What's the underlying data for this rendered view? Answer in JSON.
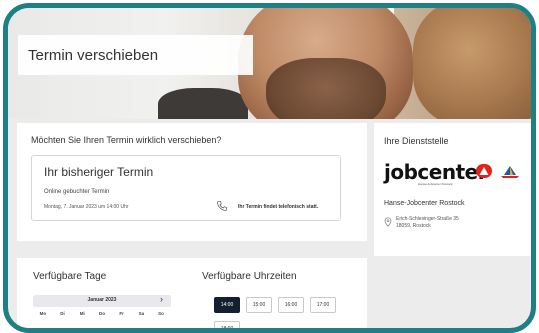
{
  "header": {
    "title": "Termin verschieben"
  },
  "question": {
    "heading": "Möchten Sie Ihren Termin wirklich verschieben?",
    "previous": {
      "title": "Ihr bisheriger Termin",
      "type": "Online gebuchter Termin",
      "datetime": "Montag, 7. Januar 2023 um 14:00 Uhr",
      "phone_note": "Ihr Termin findet telefonisch statt."
    }
  },
  "office": {
    "heading": "Ihre Dienststelle",
    "logo_text": "jobcenter",
    "logo_subtext": "Hanse-Jobcenter Rostock",
    "name": "Hanse-Jobcenter Rostock",
    "address_line1": "Erich-Schlesinger-Straße 35",
    "address_line2": "18059, Rostock"
  },
  "days": {
    "heading": "Verfügbare Tage",
    "calendar": {
      "month": "Januar 2023",
      "next_label": "›",
      "weekdays": [
        "Mo",
        "Di",
        "Mi",
        "Do",
        "Fr",
        "Sa",
        "So"
      ]
    }
  },
  "times": {
    "heading": "Verfügbare Uhrzeiten",
    "slots": [
      "14:00",
      "15:00",
      "16:00",
      "17:00",
      "18:00"
    ],
    "selected": "14:00"
  },
  "colors": {
    "frame": "#1f7f85",
    "selected_slot": "#151f32",
    "logo_red": "#e2231a"
  }
}
